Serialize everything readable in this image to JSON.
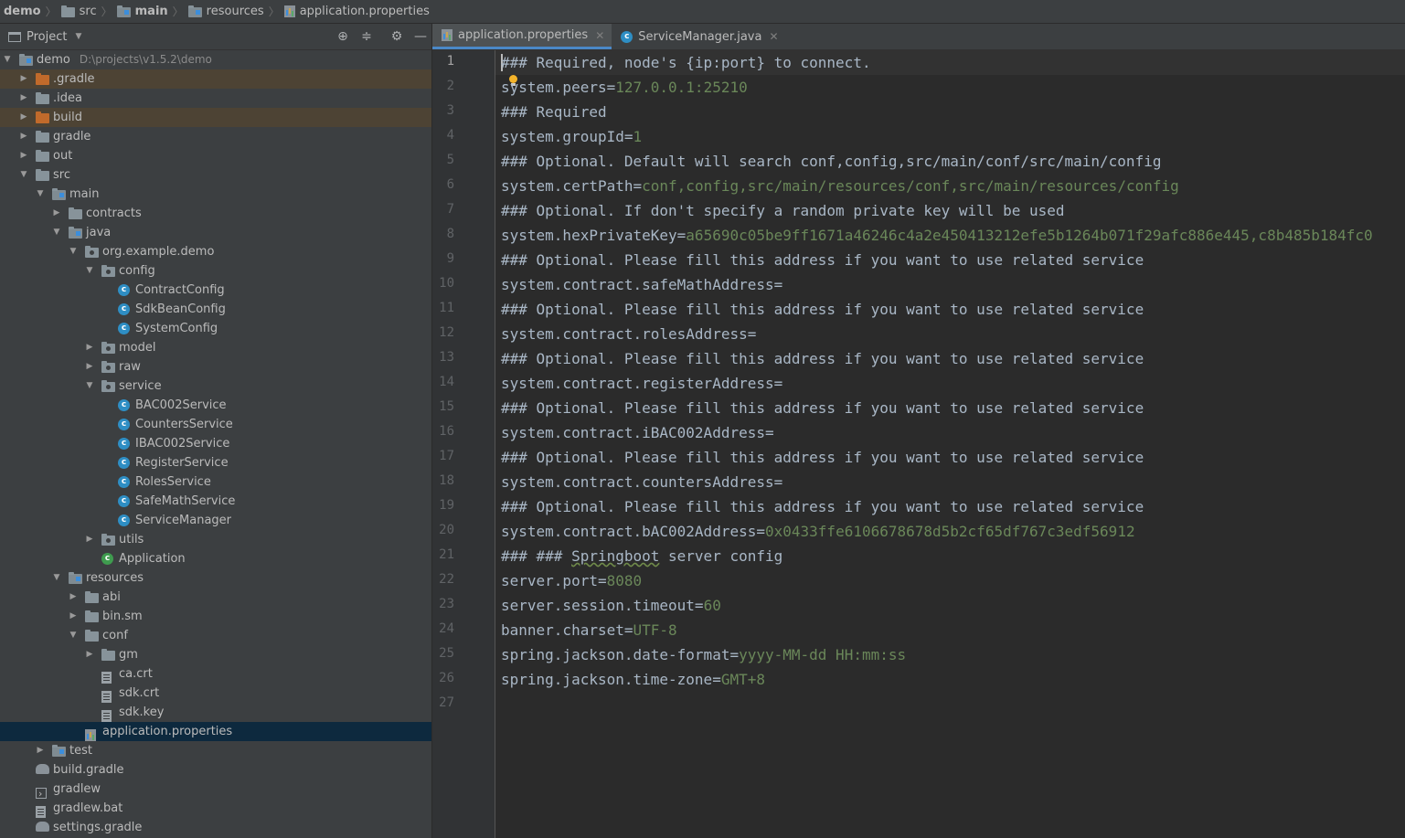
{
  "breadcrumb": [
    "demo",
    "src",
    "main",
    "resources",
    "application.properties"
  ],
  "project_panel": {
    "title": "Project",
    "tree": [
      {
        "label": "demo",
        "path": "D:\\projects\\v1.5.2\\demo",
        "depth": 0,
        "arrow": "down",
        "icon": "module-folder"
      },
      {
        "label": ".gradle",
        "depth": 1,
        "arrow": "right",
        "icon": "excluded-folder",
        "excluded": true
      },
      {
        "label": ".idea",
        "depth": 1,
        "arrow": "right",
        "icon": "folder"
      },
      {
        "label": "build",
        "depth": 1,
        "arrow": "right",
        "icon": "excluded-folder",
        "excluded": true
      },
      {
        "label": "gradle",
        "depth": 1,
        "arrow": "right",
        "icon": "folder"
      },
      {
        "label": "out",
        "depth": 1,
        "arrow": "right",
        "icon": "folder"
      },
      {
        "label": "src",
        "depth": 1,
        "arrow": "down",
        "icon": "folder"
      },
      {
        "label": "main",
        "depth": 2,
        "arrow": "down",
        "icon": "source-folder"
      },
      {
        "label": "contracts",
        "depth": 3,
        "arrow": "right",
        "icon": "folder"
      },
      {
        "label": "java",
        "depth": 3,
        "arrow": "down",
        "icon": "source-folder"
      },
      {
        "label": "org.example.demo",
        "depth": 4,
        "arrow": "down",
        "icon": "package-folder"
      },
      {
        "label": "config",
        "depth": 5,
        "arrow": "down",
        "icon": "package-folder"
      },
      {
        "label": "ContractConfig",
        "depth": 6,
        "arrow": "",
        "icon": "class-icon"
      },
      {
        "label": "SdkBeanConfig",
        "depth": 6,
        "arrow": "",
        "icon": "class-icon"
      },
      {
        "label": "SystemConfig",
        "depth": 6,
        "arrow": "",
        "icon": "class-icon"
      },
      {
        "label": "model",
        "depth": 5,
        "arrow": "right",
        "icon": "package-folder"
      },
      {
        "label": "raw",
        "depth": 5,
        "arrow": "right",
        "icon": "package-folder"
      },
      {
        "label": "service",
        "depth": 5,
        "arrow": "down",
        "icon": "package-folder"
      },
      {
        "label": "BAC002Service",
        "depth": 6,
        "arrow": "",
        "icon": "class-icon"
      },
      {
        "label": "CountersService",
        "depth": 6,
        "arrow": "",
        "icon": "class-icon"
      },
      {
        "label": "IBAC002Service",
        "depth": 6,
        "arrow": "",
        "icon": "class-icon"
      },
      {
        "label": "RegisterService",
        "depth": 6,
        "arrow": "",
        "icon": "class-icon"
      },
      {
        "label": "RolesService",
        "depth": 6,
        "arrow": "",
        "icon": "class-icon"
      },
      {
        "label": "SafeMathService",
        "depth": 6,
        "arrow": "",
        "icon": "class-icon"
      },
      {
        "label": "ServiceManager",
        "depth": 6,
        "arrow": "",
        "icon": "class-icon"
      },
      {
        "label": "utils",
        "depth": 5,
        "arrow": "right",
        "icon": "package-folder"
      },
      {
        "label": "Application",
        "depth": 5,
        "arrow": "",
        "icon": "app-class-icon"
      },
      {
        "label": "resources",
        "depth": 3,
        "arrow": "down",
        "icon": "resource-folder"
      },
      {
        "label": "abi",
        "depth": 4,
        "arrow": "right",
        "icon": "folder"
      },
      {
        "label": "bin.sm",
        "depth": 4,
        "arrow": "right",
        "icon": "folder"
      },
      {
        "label": "conf",
        "depth": 4,
        "arrow": "down",
        "icon": "folder"
      },
      {
        "label": "gm",
        "depth": 5,
        "arrow": "right",
        "icon": "folder"
      },
      {
        "label": "ca.crt",
        "depth": 5,
        "arrow": "",
        "icon": "file-icon"
      },
      {
        "label": "sdk.crt",
        "depth": 5,
        "arrow": "",
        "icon": "file-icon"
      },
      {
        "label": "sdk.key",
        "depth": 5,
        "arrow": "",
        "icon": "file-icon"
      },
      {
        "label": "application.properties",
        "depth": 4,
        "arrow": "",
        "icon": "properties-icon",
        "selected": true
      },
      {
        "label": "test",
        "depth": 2,
        "arrow": "right",
        "icon": "source-folder"
      },
      {
        "label": "build.gradle",
        "depth": 1,
        "arrow": "",
        "icon": "gradle-icon"
      },
      {
        "label": "gradlew",
        "depth": 1,
        "arrow": "",
        "icon": "terminal-file-icon"
      },
      {
        "label": "gradlew.bat",
        "depth": 1,
        "arrow": "",
        "icon": "file-icon"
      },
      {
        "label": "settings.gradle",
        "depth": 1,
        "arrow": "",
        "icon": "gradle-icon"
      }
    ]
  },
  "editor": {
    "tabs": [
      {
        "label": "application.properties",
        "active": true,
        "icon": "properties-icon"
      },
      {
        "label": "ServiceManager.java",
        "active": false,
        "icon": "class-icon"
      }
    ],
    "current_line": 1,
    "lines": [
      {
        "type": "comment",
        "text": "### Required, node's {ip:port} to connect."
      },
      {
        "type": "kv",
        "key": "system.peers",
        "value": "127.0.0.1:25210"
      },
      {
        "type": "comment",
        "text": "### Required"
      },
      {
        "type": "kv",
        "key": "system.groupId",
        "value": "1"
      },
      {
        "type": "comment",
        "text": "### Optional. Default will search conf,config,src/main/conf/src/main/config"
      },
      {
        "type": "kv",
        "key": "system.certPath",
        "value": "conf,config,src/main/resources/conf,src/main/resources/config"
      },
      {
        "type": "comment",
        "text": "### Optional. If don't specify a random private key will be used"
      },
      {
        "type": "kv",
        "key": "system.hexPrivateKey",
        "value": "a65690c05be9ff1671a46246c4a2e450413212efe5b1264b071f29afc886e445,c8b485b184fc0"
      },
      {
        "type": "comment",
        "text": "### Optional. Please fill this address if you want to use related service"
      },
      {
        "type": "kv",
        "key": "system.contract.safeMathAddress",
        "value": ""
      },
      {
        "type": "comment",
        "text": "### Optional. Please fill this address if you want to use related service"
      },
      {
        "type": "kv",
        "key": "system.contract.rolesAddress",
        "value": ""
      },
      {
        "type": "comment",
        "text": "### Optional. Please fill this address if you want to use related service"
      },
      {
        "type": "kv",
        "key": "system.contract.registerAddress",
        "value": ""
      },
      {
        "type": "comment",
        "text": "### Optional. Please fill this address if you want to use related service"
      },
      {
        "type": "kv",
        "key": "system.contract.iBAC002Address",
        "value": ""
      },
      {
        "type": "comment",
        "text": "### Optional. Please fill this address if you want to use related service"
      },
      {
        "type": "kv",
        "key": "system.contract.countersAddress",
        "value": ""
      },
      {
        "type": "comment",
        "text": "### Optional. Please fill this address if you want to use related service"
      },
      {
        "type": "kv",
        "key": "system.contract.bAC002Address",
        "value": "0x0433ffe6106678678d5b2cf65df767c3edf56912"
      },
      {
        "type": "comment",
        "text": "### ### Springboot server config"
      },
      {
        "type": "kv",
        "key": "server.port",
        "value": "8080"
      },
      {
        "type": "kv",
        "key": "server.session.timeout",
        "value": "60"
      },
      {
        "type": "kv",
        "key": "banner.charset",
        "value": "UTF-8"
      },
      {
        "type": "kv",
        "key": "spring.jackson.date-format",
        "value": "yyyy-MM-dd HH:mm:ss"
      },
      {
        "type": "kv",
        "key": "spring.jackson.time-zone",
        "value": "GMT+8"
      },
      {
        "type": "empty",
        "text": ""
      }
    ]
  }
}
